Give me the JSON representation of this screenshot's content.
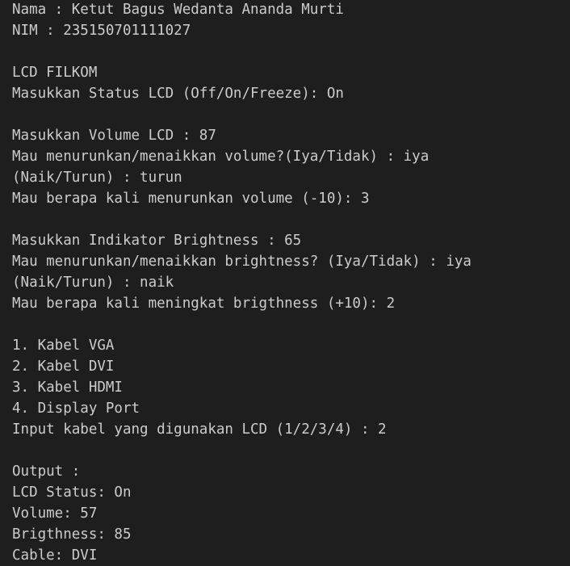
{
  "terminal": {
    "lines": [
      "Nama : Ketut Bagus Wedanta Ananda Murti",
      "NIM : 235150701111027",
      "",
      "LCD FILKOM",
      "Masukkan Status LCD (Off/On/Freeze): On",
      "",
      "Masukkan Volume LCD : 87",
      "Mau menurunkan/menaikkan volume?(Iya/Tidak) : iya",
      "(Naik/Turun) : turun",
      "Mau berapa kali menurunkan volume (-10): 3",
      "",
      "Masukkan Indikator Brightness : 65",
      "Mau menurunkan/menaikkan brightness? (Iya/Tidak) : iya",
      "(Naik/Turun) : naik",
      "Mau berapa kali meningkat brigthness (+10): 2",
      "",
      "1. Kabel VGA",
      "2. Kabel DVI",
      "3. Kabel HDMI",
      "4. Display Port",
      "Input kabel yang digunakan LCD (1/2/3/4) : 2",
      "",
      "Output :",
      "LCD Status: On",
      "Volume: 57",
      "Brigthness: 85",
      "Cable: DVI"
    ]
  }
}
